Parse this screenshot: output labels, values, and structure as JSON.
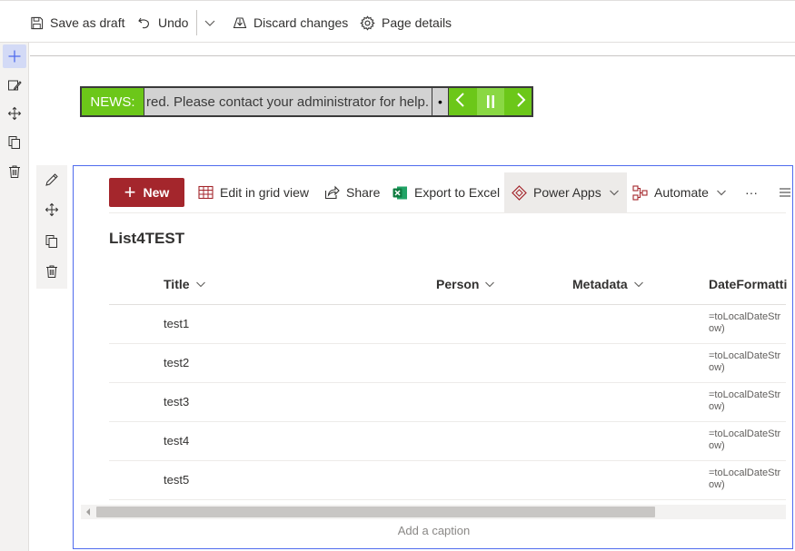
{
  "toolbar": {
    "save_label": "Save as draft",
    "undo_label": "Undo",
    "discard_label": "Discard changes",
    "details_label": "Page details"
  },
  "rail": {
    "icons": [
      "add-icon",
      "edit-section-icon",
      "move-icon",
      "duplicate-icon",
      "delete-icon"
    ]
  },
  "ticker": {
    "label": "NEWS:",
    "text": "red. Please contact your administrator for help.",
    "dot": "•",
    "colors": {
      "accent": "#6cc719",
      "text_bg": "#d2d2d2"
    }
  },
  "list": {
    "new_label": "New",
    "commands": {
      "grid": "Edit in grid view",
      "share": "Share",
      "export": "Export to Excel",
      "power_apps": "Power Apps",
      "automate": "Automate",
      "more": "···"
    },
    "title": "List4TEST",
    "columns": [
      "Title",
      "Person",
      "Metadata",
      "DateFormatti"
    ],
    "rows": [
      {
        "title": "test1",
        "date_line1": "=toLocalDateStr",
        "date_line2": "ow)"
      },
      {
        "title": "test2",
        "date_line1": "=toLocalDateStr",
        "date_line2": "ow)"
      },
      {
        "title": "test3",
        "date_line1": "=toLocalDateStr",
        "date_line2": "ow)"
      },
      {
        "title": "test4",
        "date_line1": "=toLocalDateStr",
        "date_line2": "ow)"
      },
      {
        "title": "test5",
        "date_line1": "=toLocalDateStr",
        "date_line2": "ow)"
      }
    ],
    "caption_placeholder": "Add a caption",
    "colors": {
      "new_button": "#a4262c",
      "selection_border": "#4f6bed"
    }
  }
}
